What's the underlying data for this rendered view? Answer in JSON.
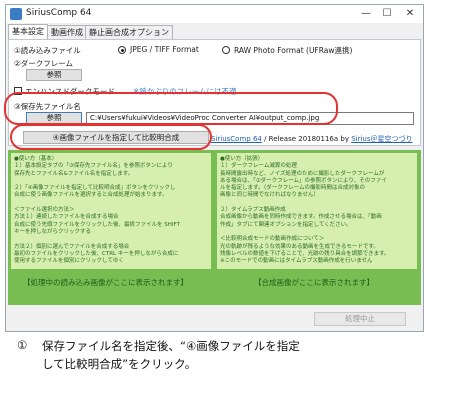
{
  "window": {
    "title": "SiriusComp 64",
    "controls": {
      "minimize": "—",
      "maximize": "☐",
      "close": "✕"
    }
  },
  "tabs": [
    "基本設定",
    "動画作成",
    "静止画合成オプション"
  ],
  "read_file": {
    "heading": "①読み込みファイル",
    "button": "参照",
    "options": [
      "JPEG / TIFF Format",
      "RAW Photo Format (UFRaw連携)"
    ],
    "selected": "JPEG / TIFF Format"
  },
  "dark_frame": {
    "heading": "②ダークフレーム",
    "button": "参照",
    "enhanced_label": "エンハンスドダークモード",
    "enhanced_checked": false,
    "note": "※熱かぶりのフレームには不適"
  },
  "save_file": {
    "heading": "③保存先ファイル名",
    "button": "参照",
    "path": "C:¥Users¥fukui¥Videos¥VideoProc Converter AI¥output_comp.jpg"
  },
  "compose_button": "④画像ファイルを指定して比較明合成",
  "version_line": {
    "app_link": "SiriusComp 64",
    "release": " / Release 20180116a by ",
    "author_link": "Sirius＠星空つづり"
  },
  "help_left": {
    "text": "●使い方（基本）\n１）基本設定タブの「③保存先ファイル名」を参照ボタンにより\n保存先とファイル名&ファイル名を指定します。\n\n２）「④画像ファイルを指定して比較明合成」ボタンをクリックし\n合成に使う画像ファイルを選択すると合成処理が始まります。\n\n＜ファイル選択の方法＞\n方法１）連続したファイルを合成する場合\n合成に使う先頭ファイルをクリックした後、最終ファイルを SHIFT\nキーを押しながらクリックする\n\n方法２）個別に選んでファイルを合成する場合\n最初のファイルをクリックした後、CTRL キーを押しながら合成に\n使用するファイルを個別にクリックしてゆく",
    "caption": "【処理中の読み込み画像がここに表示されます】"
  },
  "help_right": {
    "text": "●使い方（拡張）\n１）ダークフレーム減算の処理\n長時間露出時など、ノイズ処理のために撮影したダークフレームが\nある場合は、「②ダークフレーム」の参照ボタンにより、そのファイ\nルを指定します。（ダークフレームの撮影時間は合成対象の\n画像と同じ時間でなければなりません）\n\n２）タイムラプス動画作成\n合成画像から動画を同時作成できます。作成させる場合は、「動画\n作成」タブにて関連オプションを指定してください。\n\n＜比較明合成モードの動画作成について＞\n光の軌跡が残るような効果のある動画を生成できるモードです。\n残像レベルの数値を下げることで、光跡の残り具合を調節できます。\n※このモードでの動画にはタイムラプス動画作成を行いません\n\n詳しい使い方や内容はSiriusComp 配布サイトをご覧ください",
    "caption": "【合成画像がここに表示されます】"
  },
  "stop_button": "処理中止",
  "instruction": {
    "number": "①",
    "line1": "保存ファイル名を指定後、“④画像ファイルを指定",
    "line2": "して比較明合成”をクリック。"
  }
}
